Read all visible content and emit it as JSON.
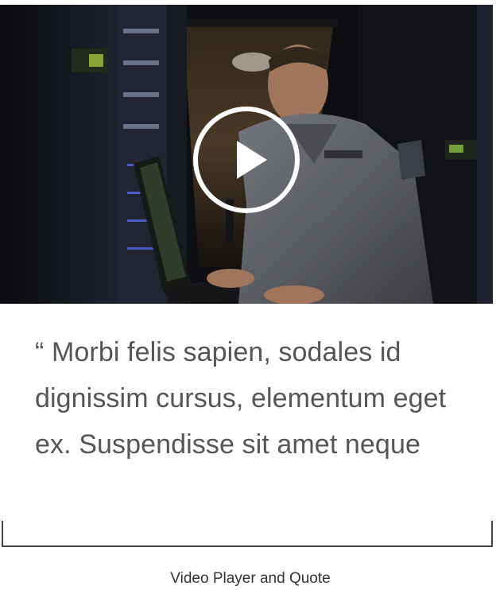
{
  "video": {
    "play_icon": "play-icon",
    "colors": {
      "background": "#111114",
      "play_ring": "#ffffff"
    }
  },
  "quote": {
    "text": "“ Morbi felis sapien, sodales id dignissim cursus, elementum eget ex. Suspendisse sit amet neque"
  },
  "caption": "Video Player and Quote",
  "colors": {
    "quote_text": "#555555",
    "bracket": "#444444",
    "caption": "#333333"
  }
}
